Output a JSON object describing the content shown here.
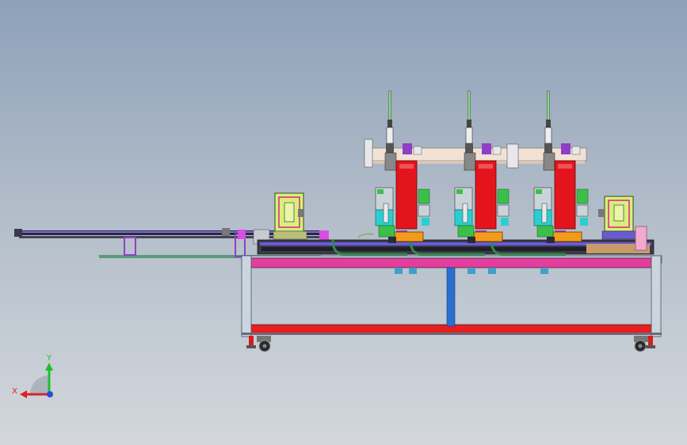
{
  "triad": {
    "x_label": "X",
    "y_label": "Y",
    "x_color": "#e0202a",
    "y_color": "#1fbf2a",
    "z_color": "#2a4cd8"
  },
  "colors": {
    "frame_magenta": "#e43d9d",
    "frame_red": "#e81e22",
    "frame_blue": "#2a6fd0",
    "frame_silver": "#c9d6de",
    "press_red": "#e4141c",
    "orange_base": "#f39a1a",
    "cyan_parts": "#27d0d0",
    "lime_cabinet": "#d7f07a",
    "pink_block": "#f3a9cf"
  },
  "model": {
    "press_units": 3
  }
}
